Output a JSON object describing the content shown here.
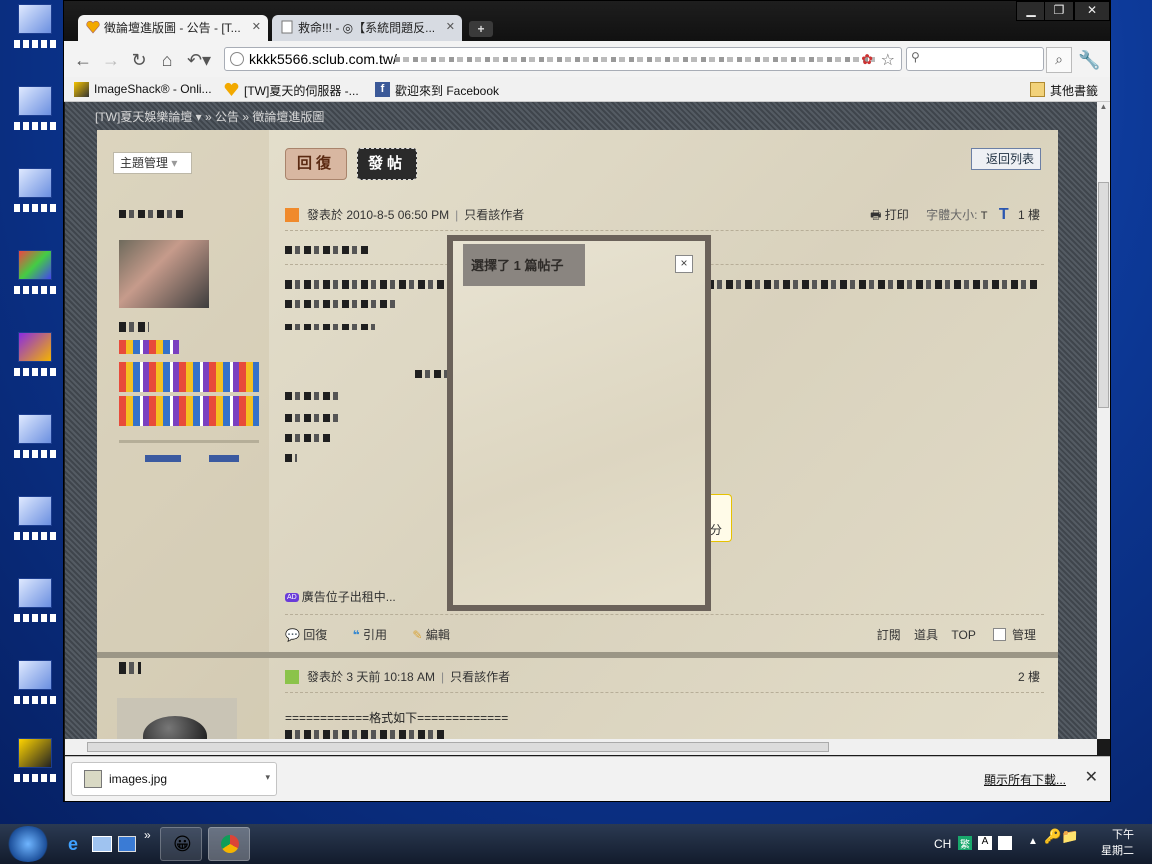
{
  "browser": {
    "tabs": [
      {
        "title": "徵論壇進版圖 - 公告 - [T..."
      },
      {
        "title": "救命!!! - ◎【系統問題反..."
      }
    ],
    "url": "kkkk5566.sclub.com.tw/",
    "bookmarks": [
      {
        "label": "ImageShack® - Onli..."
      },
      {
        "label": "[TW]夏天的伺服器 -..."
      },
      {
        "label": "歡迎來到 Facebook"
      }
    ],
    "other_bookmarks": "其他書籤"
  },
  "forum": {
    "breadcrumb": "[TW]夏天娛樂論壇 ▾ » 公告 » 徵論壇進版圖",
    "topic_manage": "主題管理",
    "reply_btn": "回復",
    "post_btn": "發帖",
    "back_to_list": "返回列表",
    "post1": {
      "meta": "發表於 2010-8-5 06:50 PM",
      "only_author": "只看該作者",
      "print": "打印",
      "font_size": "字體大小:",
      "font_small": "T",
      "font_large": "T",
      "floor": "1 樓",
      "ad": "廣告位子出租中...",
      "score_fragment": "分"
    },
    "actions": {
      "reply": "回復",
      "quote": "引用",
      "edit": "編輯",
      "subscribe": "訂閱",
      "tools": "道具",
      "top": "TOP",
      "manage": "管理"
    },
    "post2": {
      "meta": "發表於 3 天前 10:18 AM",
      "only_author": "只看該作者",
      "floor": "2 樓",
      "body_line": "============格式如下============="
    }
  },
  "modal": {
    "title": "選擇了 1 篇帖子",
    "close": "×"
  },
  "downloads": {
    "file": "images.jpg",
    "show_all": "顯示所有下載..."
  },
  "taskbar": {
    "lang": "CH",
    "time": "下午",
    "day": "星期二"
  },
  "colors": {
    "modal_border": "#6b625a",
    "paper": "#e2dcc8",
    "accent_orange": "#f08a2c"
  }
}
